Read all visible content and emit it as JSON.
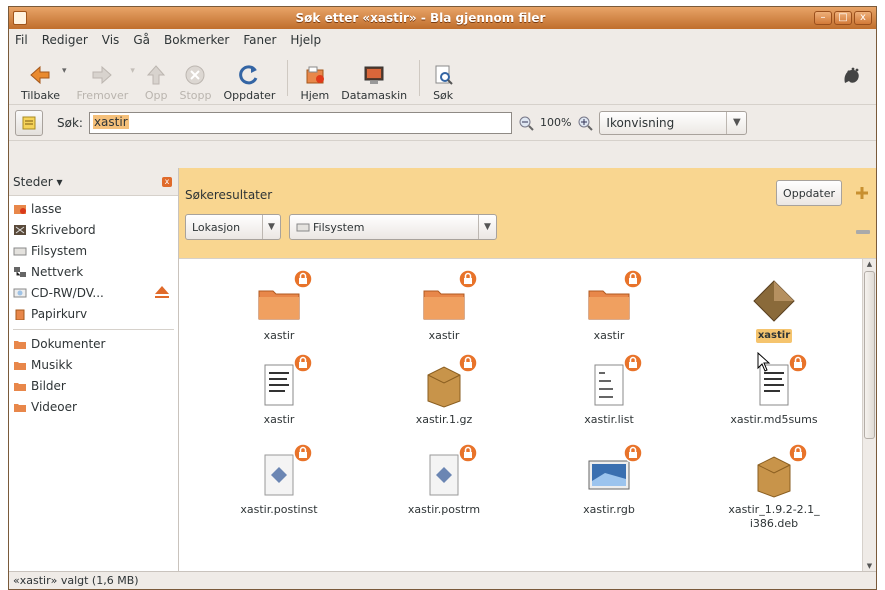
{
  "window": {
    "title": "Søk etter «xastir» - Bla gjennom filer",
    "buttons": {
      "minimize": "–",
      "maximize": "□",
      "close": "x"
    }
  },
  "menu": [
    {
      "label": "Fil"
    },
    {
      "label": "Rediger"
    },
    {
      "label": "Vis"
    },
    {
      "label": "Gå"
    },
    {
      "label": "Bokmerker"
    },
    {
      "label": "Faner"
    },
    {
      "label": "Hjelp"
    }
  ],
  "toolbar": {
    "back": "Tilbake",
    "forward": "Fremover",
    "up": "Opp",
    "stop": "Stopp",
    "reload": "Oppdater",
    "home": "Hjem",
    "computer": "Datamaskin",
    "search": "Søk"
  },
  "searchbar": {
    "label": "Søk:",
    "query": "xastir",
    "zoom": "100%",
    "view": "Ikonvisning"
  },
  "sidebar": {
    "header": "Steder",
    "items": [
      {
        "label": "lasse",
        "icon": "home-folder-icon"
      },
      {
        "label": "Skrivebord",
        "icon": "desktop-icon"
      },
      {
        "label": "Filsystem",
        "icon": "drive-icon"
      },
      {
        "label": "Nettverk",
        "icon": "network-icon"
      },
      {
        "label": "CD-RW/DV...",
        "icon": "cdrom-icon"
      },
      {
        "label": "Papirkurv",
        "icon": "trash-icon"
      },
      {
        "label": "Dokumenter",
        "icon": "folder-icon"
      },
      {
        "label": "Musikk",
        "icon": "folder-icon"
      },
      {
        "label": "Bilder",
        "icon": "folder-icon"
      },
      {
        "label": "Videoer",
        "icon": "folder-icon"
      }
    ]
  },
  "results": {
    "title": "Søkeresultater",
    "update_button": "Oppdater",
    "location_combo": "Lokasjon",
    "filesystem_combo": "Filsystem"
  },
  "files": [
    {
      "name": "xastir",
      "type": "folder"
    },
    {
      "name": "xastir",
      "type": "folder"
    },
    {
      "name": "xastir",
      "type": "folder"
    },
    {
      "name": "xastir",
      "type": "executable"
    },
    {
      "name": "xastir",
      "type": "text"
    },
    {
      "name": "xastir.1.gz",
      "type": "archive"
    },
    {
      "name": "xastir.list",
      "type": "text-list"
    },
    {
      "name": "xastir.md5sums",
      "type": "text-md5"
    },
    {
      "name": "xastir.postinst",
      "type": "script"
    },
    {
      "name": "xastir.postrm",
      "type": "script"
    },
    {
      "name": "xastir.rgb",
      "type": "image"
    },
    {
      "name": "xastir_1.9.2-2.1_\ni386.deb",
      "type": "package"
    }
  ],
  "statusbar": "«xastir» valgt (1,6 MB)",
  "colors": {
    "titlebar": "#c06e2c",
    "results_bar": "#f9d690",
    "selection": "#f5c46e",
    "folder": "#e8874a"
  }
}
